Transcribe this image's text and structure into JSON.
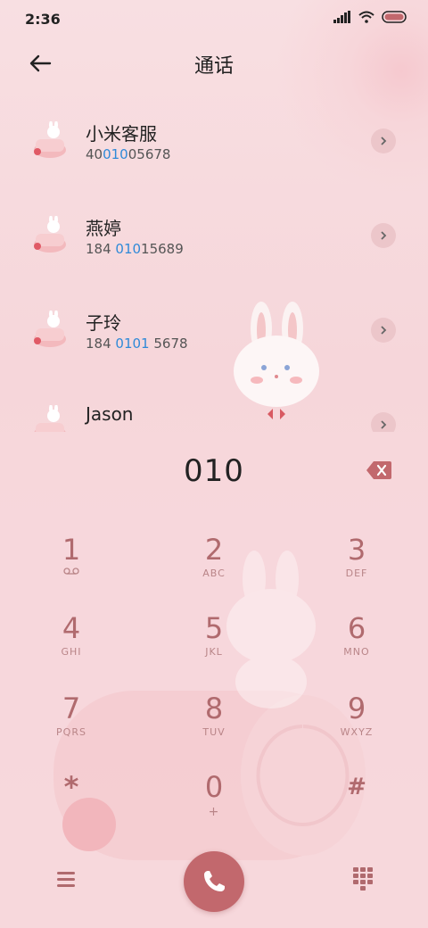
{
  "status_bar": {
    "time": "2:36"
  },
  "header": {
    "title": "通话"
  },
  "contacts": [
    {
      "name": "小米客服",
      "num_pre": "40",
      "num_hl": "010",
      "num_post": "05678"
    },
    {
      "name": "燕婷",
      "num_pre": "184 ",
      "num_hl": "010",
      "num_post": "15689"
    },
    {
      "name": "子玲",
      "num_pre": "184 ",
      "num_hl": "0101",
      "num_post": " 5678"
    },
    {
      "name": "Jason",
      "num_pre": "",
      "num_hl": "",
      "num_post": ""
    }
  ],
  "dialer": {
    "entry": "010",
    "keys": [
      {
        "digit": "1",
        "letters": ""
      },
      {
        "digit": "2",
        "letters": "ABC"
      },
      {
        "digit": "3",
        "letters": "DEF"
      },
      {
        "digit": "4",
        "letters": "GHI"
      },
      {
        "digit": "5",
        "letters": "JKL"
      },
      {
        "digit": "6",
        "letters": "MNO"
      },
      {
        "digit": "7",
        "letters": "PQRS"
      },
      {
        "digit": "8",
        "letters": "TUV"
      },
      {
        "digit": "9",
        "letters": "WXYZ"
      },
      {
        "digit": "*",
        "letters": ""
      },
      {
        "digit": "0",
        "letters": "+"
      },
      {
        "digit": "#",
        "letters": ""
      }
    ]
  },
  "icons": {
    "back": "back-arrow-icon",
    "delete": "backspace-icon",
    "menu": "hamburger-menu-icon",
    "call": "phone-icon",
    "keypad": "dialpad-icon",
    "voicemail": "voicemail-icon"
  },
  "colors": {
    "accent": "#c2686d",
    "highlight": "#2f8ad8",
    "digit": "#b06a6e"
  }
}
